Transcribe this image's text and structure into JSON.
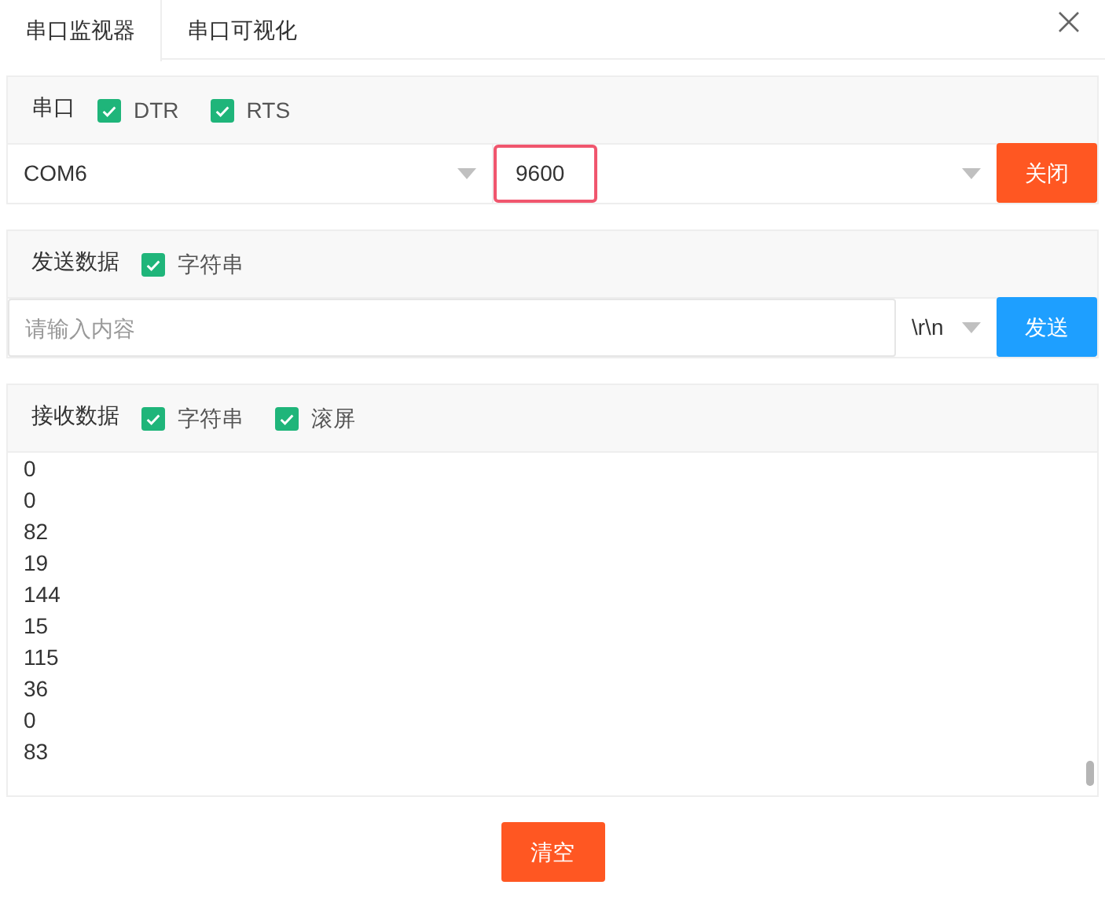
{
  "tabs": [
    {
      "label": "串口监视器",
      "selected": true
    },
    {
      "label": "串口可视化",
      "selected": false
    }
  ],
  "port": {
    "label": "串口",
    "options": [
      {
        "label": "DTR",
        "checked": true
      },
      {
        "label": "RTS",
        "checked": true
      }
    ],
    "port_select": "COM6",
    "baud_select": {
      "value": "9600",
      "focused": true
    },
    "button": "关闭"
  },
  "send": {
    "label": "发送数据",
    "options": [
      {
        "label": "字符串",
        "checked": true
      }
    ],
    "input": {
      "placeholder": "请输入内容"
    },
    "line_ending": "\\r\\n",
    "button": "发送"
  },
  "receive": {
    "label": "接收数据",
    "options": [
      {
        "label": "字符串",
        "checked": true
      },
      {
        "label": "滚屏",
        "checked": true
      }
    ],
    "lines": [
      "0",
      "0",
      "82",
      "19",
      "144",
      "15",
      "115",
      "36",
      "0",
      "83"
    ]
  },
  "clear_button": "清空"
}
